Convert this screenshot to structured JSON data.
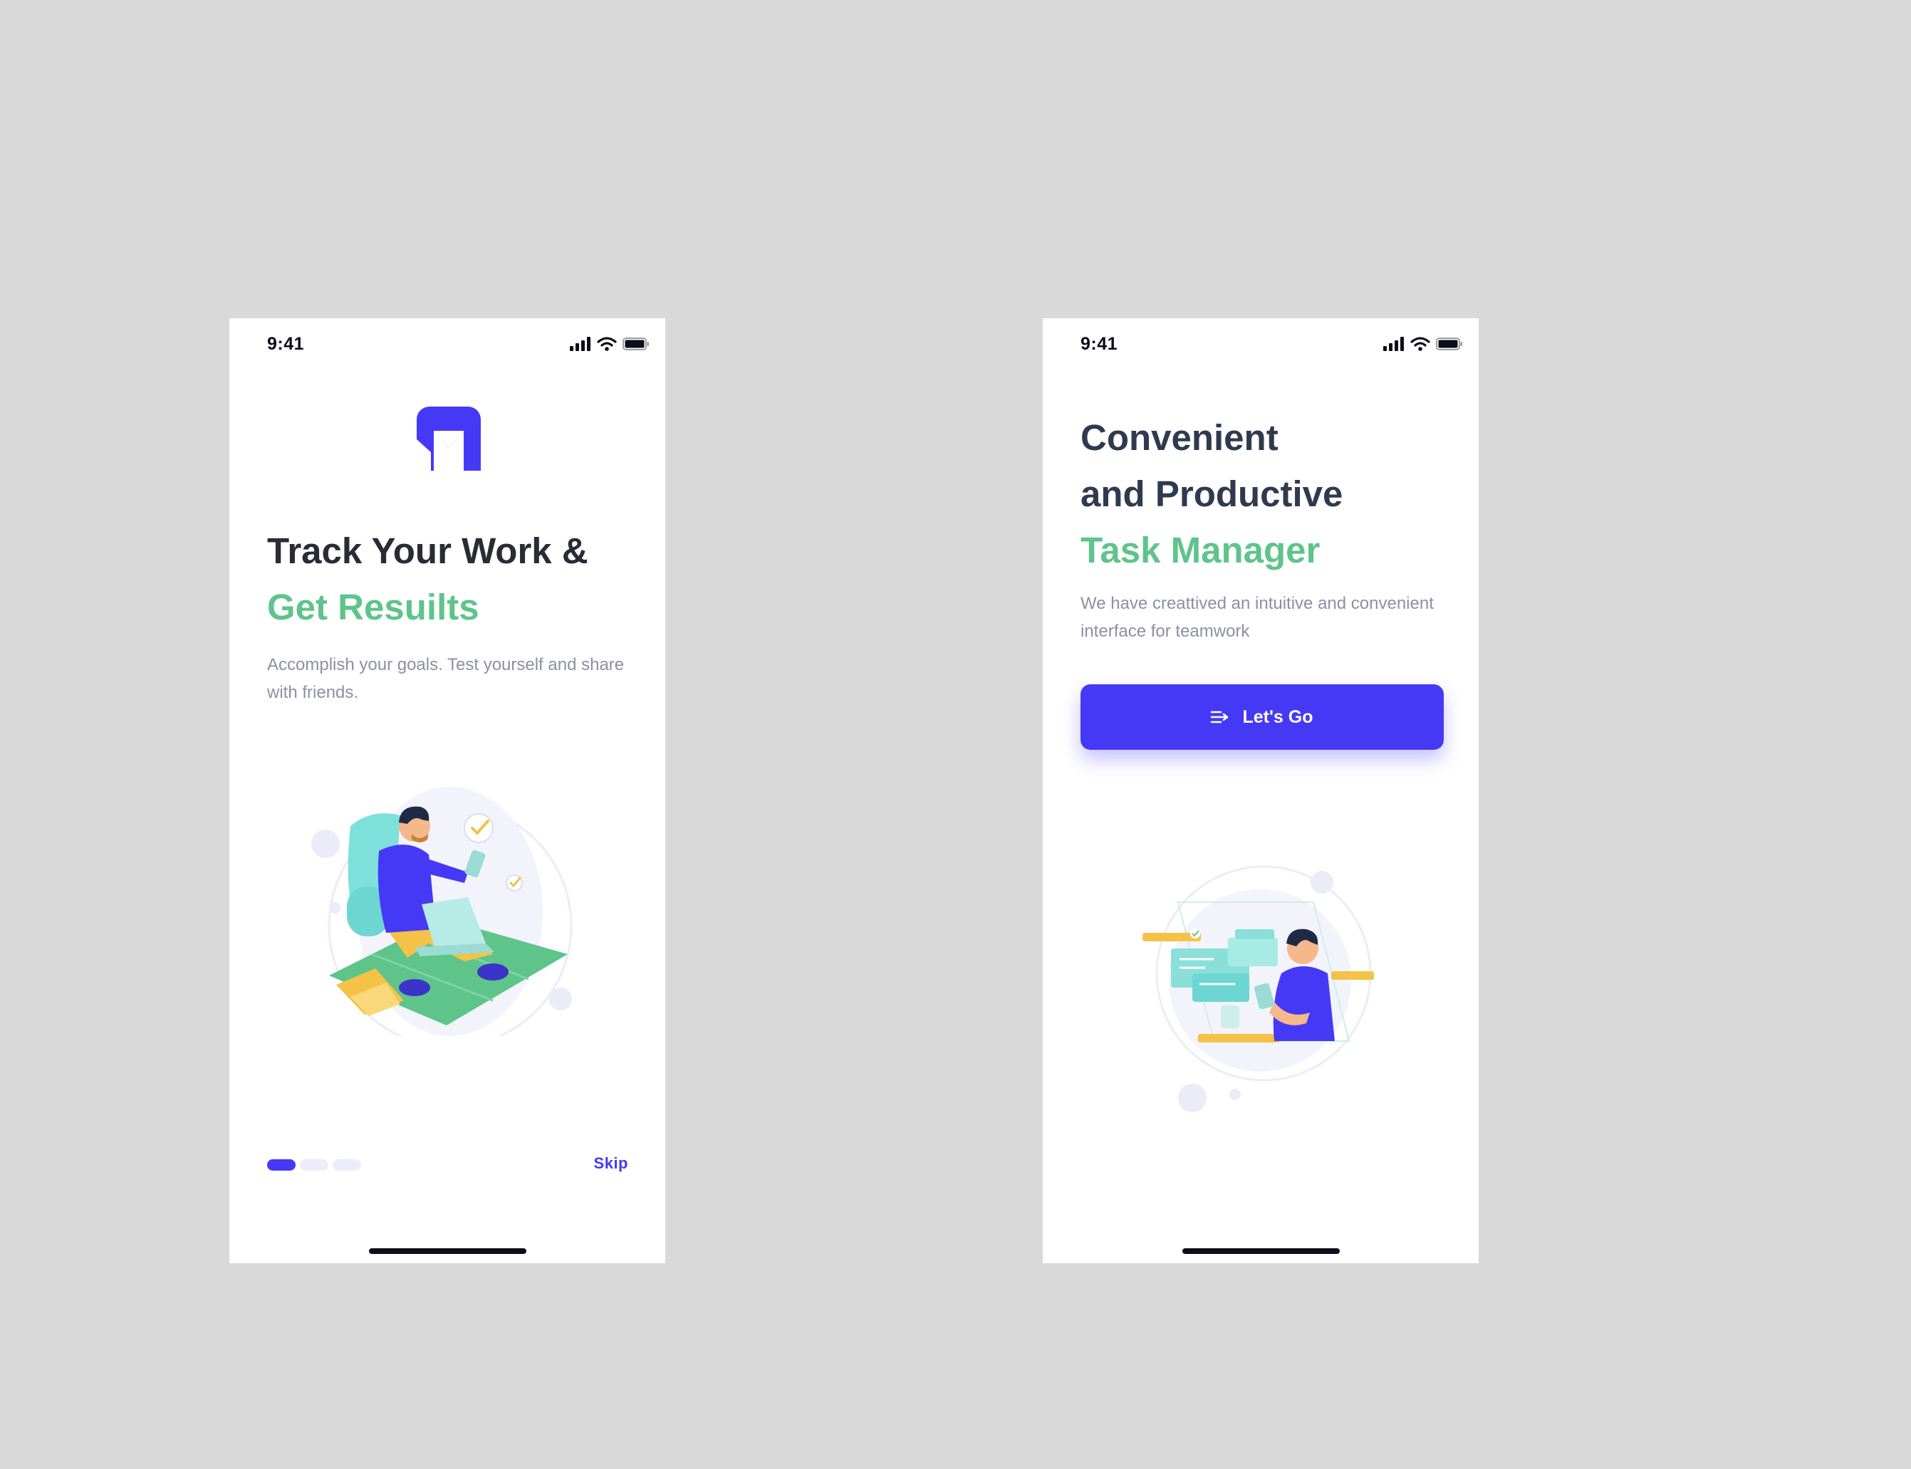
{
  "screens": [
    {
      "status_time": "9:41",
      "headline_line1": "Track Your Work &",
      "headline_line2": "Get Resuilts",
      "body": "Accomplish your goals. Test yourself and share with friends.",
      "pagination": {
        "total": 3,
        "active": 1
      },
      "skip_label": "Skip"
    },
    {
      "status_time": "9:41",
      "headline_line1": "Convenient",
      "headline_line2": "and Productive",
      "headline_line3": "Task Manager",
      "body": "We have creattived an intuitive and convenient interface for teamwork",
      "button_label": "Let's Go"
    }
  ],
  "colors": {
    "background": "#d9d9d9",
    "primary": "#4539f6",
    "accent_green": "#5ec48a",
    "headline_dark": "#2b2b36",
    "headline_slate": "#2f3a4f",
    "body_gray": "#8d8fa3"
  },
  "icons": [
    "signal-icon",
    "wifi-icon",
    "battery-icon",
    "app-logo-icon",
    "lets-go-arrow-icon"
  ]
}
